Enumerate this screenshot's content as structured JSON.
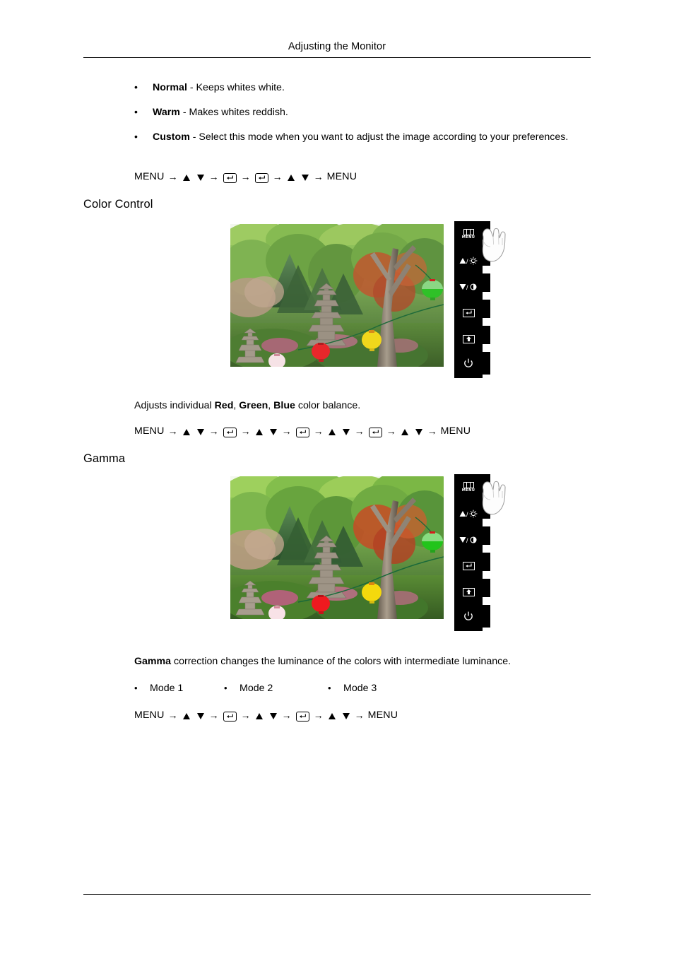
{
  "header": {
    "title": "Adjusting the Monitor"
  },
  "color_temp_bullets": [
    {
      "term": "Normal",
      "rest": " - Keeps whites white."
    },
    {
      "term": "Warm",
      "rest": " - Makes whites reddish."
    },
    {
      "term": "Custom",
      "rest": " - Select this mode when you want to adjust the image according to your preferences."
    }
  ],
  "menu_paths": {
    "color_temp": [
      "MENU",
      "updown",
      "enter",
      "enter",
      "updown",
      "MENU"
    ],
    "color_control": [
      "MENU",
      "updown",
      "enter",
      "updown",
      "enter",
      "updown",
      "enter",
      "updown",
      "MENU"
    ],
    "gamma": [
      "MENU",
      "updown",
      "enter",
      "updown",
      "enter",
      "updown",
      "MENU"
    ]
  },
  "sections": {
    "color_control": {
      "heading": "Color Control",
      "description_pre": "Adjusts individual ",
      "description_terms": [
        "Red",
        "Green",
        "Blue"
      ],
      "description_post": " color balance."
    },
    "gamma": {
      "heading": "Gamma",
      "description_term": "Gamma",
      "description_rest": " correction changes the luminance of the colors with intermediate luminance.",
      "modes": [
        "Mode 1",
        "Mode 2",
        "Mode 3"
      ]
    }
  },
  "monitor_panel": {
    "buttons": [
      {
        "name": "menu",
        "label": "MENU",
        "icon": "menu-bars-icon"
      },
      {
        "name": "brightness",
        "label": "▲/☼",
        "icon": "up-brightness-icon"
      },
      {
        "name": "contrast",
        "label": "▼/◑",
        "icon": "down-contrast-icon"
      },
      {
        "name": "enter",
        "label": "↵",
        "icon": "enter-icon"
      },
      {
        "name": "source",
        "label": "⇧",
        "icon": "source-icon"
      },
      {
        "name": "power",
        "label": "⏻",
        "icon": "power-icon"
      }
    ],
    "cursor": "pointing-hand-cursor"
  },
  "photo": {
    "alt": "Korean garden with stone pagodas and paper lanterns",
    "lanterns": [
      "green",
      "yellow",
      "red",
      "pink"
    ]
  },
  "colors": {
    "text": "#000000",
    "panel_bg": "#000000",
    "page_bg": "#ffffff"
  }
}
